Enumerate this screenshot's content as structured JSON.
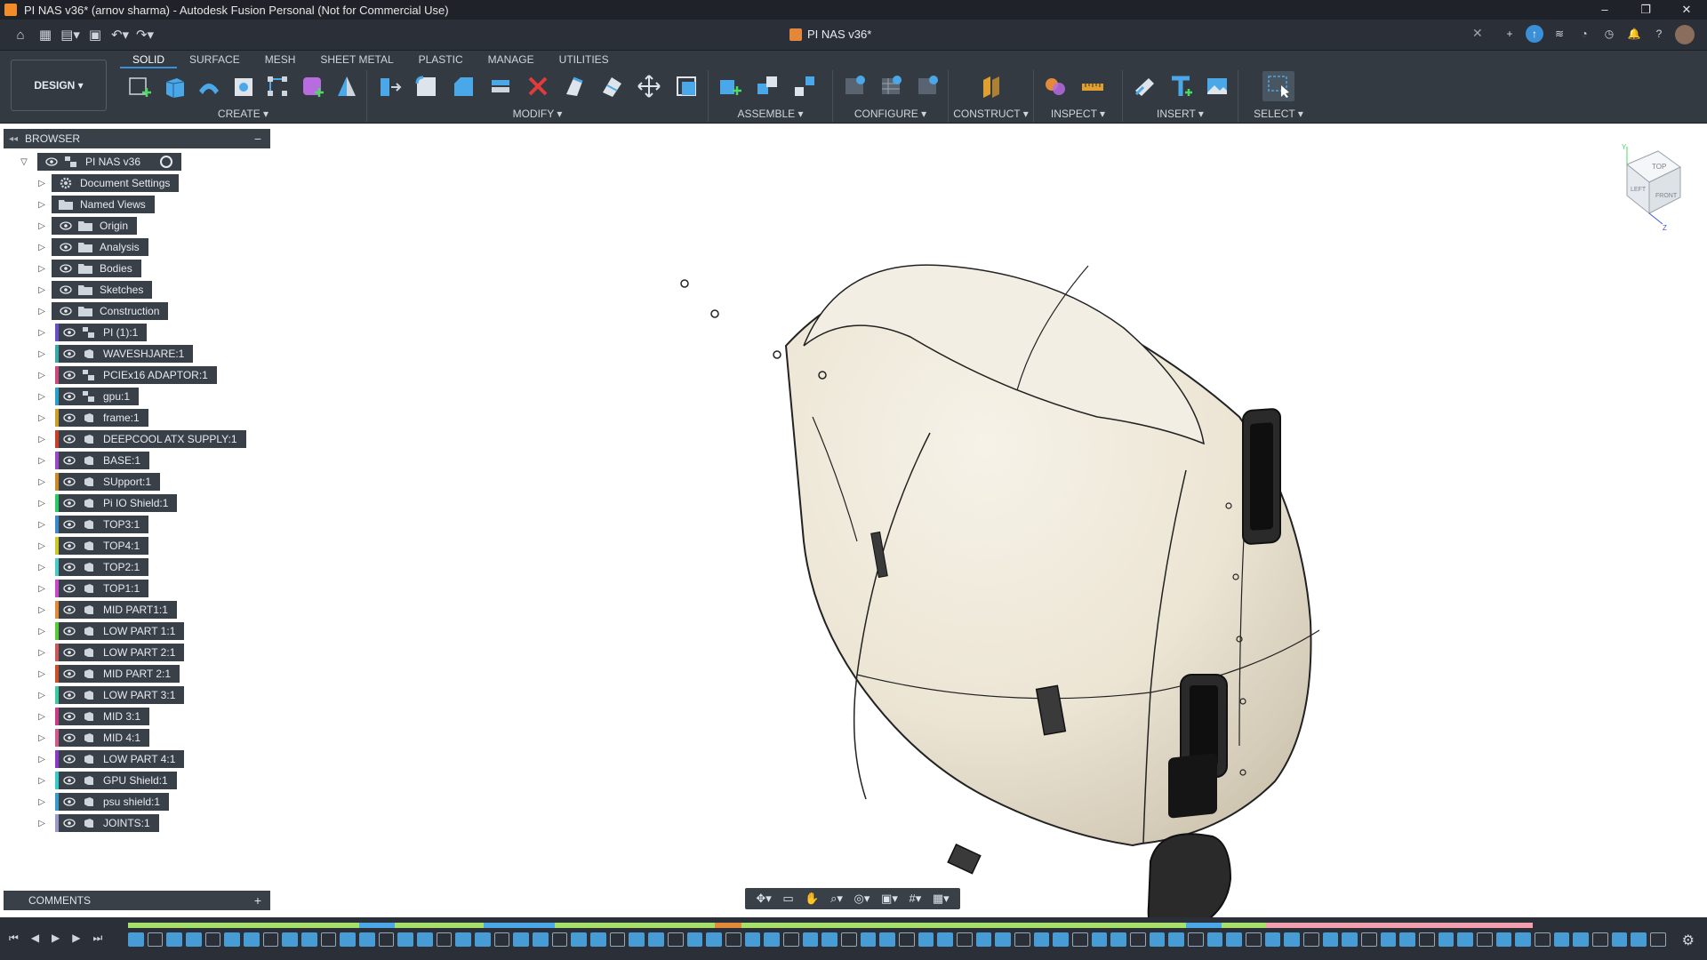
{
  "window": {
    "title": "PI NAS v36* (arnov sharma) - Autodesk Fusion Personal (Not for Commercial Use)",
    "controls": [
      "–",
      "❐",
      "✕"
    ]
  },
  "doc_tab": {
    "label": "PI NAS v36*"
  },
  "workspace": {
    "label": "DESIGN ▾"
  },
  "ribbon": {
    "tabs": [
      "SOLID",
      "SURFACE",
      "MESH",
      "SHEET METAL",
      "PLASTIC",
      "MANAGE",
      "UTILITIES"
    ],
    "groups": [
      {
        "label": "CREATE ▾"
      },
      {
        "label": "MODIFY ▾"
      },
      {
        "label": "ASSEMBLE ▾"
      },
      {
        "label": "CONFIGURE ▾"
      },
      {
        "label": "CONSTRUCT ▾"
      },
      {
        "label": "INSPECT ▾"
      },
      {
        "label": "INSERT ▾"
      },
      {
        "label": "SELECT ▾"
      }
    ]
  },
  "browser": {
    "title": "BROWSER",
    "root": "PI NAS v36",
    "items": [
      {
        "label": "Document Settings",
        "kind": "settings"
      },
      {
        "label": "Named Views",
        "kind": "folder"
      },
      {
        "label": "Origin",
        "kind": "folder"
      },
      {
        "label": "Analysis",
        "kind": "folder"
      },
      {
        "label": "Bodies",
        "kind": "folder"
      },
      {
        "label": "Sketches",
        "kind": "folder"
      },
      {
        "label": "Construction",
        "kind": "folder"
      },
      {
        "label": "PI (1):1",
        "kind": "assembly",
        "color": "#6a4fc9"
      },
      {
        "label": "WAVESHJARE:1",
        "kind": "component",
        "color": "#3aa8a8"
      },
      {
        "label": "PCIEx16 ADAPTOR:1",
        "kind": "assembly",
        "color": "#c94a7a"
      },
      {
        "label": "gpu:1",
        "kind": "assembly",
        "color": "#2aa0c9"
      },
      {
        "label": "frame:1",
        "kind": "component",
        "color": "#c9a02a"
      },
      {
        "label": "DEEPCOOL ATX SUPPLY:1",
        "kind": "component",
        "color": "#c9402a"
      },
      {
        "label": "BASE:1",
        "kind": "component",
        "color": "#9a4ac9"
      },
      {
        "label": "SUpport:1",
        "kind": "component",
        "color": "#c98a2a"
      },
      {
        "label": "Pi IO Shield:1",
        "kind": "component",
        "color": "#2ac96a"
      },
      {
        "label": "TOP3:1",
        "kind": "component",
        "color": "#3a8ac9"
      },
      {
        "label": "TOP4:1",
        "kind": "component",
        "color": "#c9c92a"
      },
      {
        "label": "TOP2:1",
        "kind": "component",
        "color": "#4ac9c9"
      },
      {
        "label": "TOP1:1",
        "kind": "component",
        "color": "#c94ac9"
      },
      {
        "label": "MID PART1:1",
        "kind": "component",
        "color": "#e08a3a"
      },
      {
        "label": "LOW PART 1:1",
        "kind": "component",
        "color": "#5ac93a"
      },
      {
        "label": "LOW PART 2:1",
        "kind": "component",
        "color": "#c95a5a"
      },
      {
        "label": "MID PART 2:1",
        "kind": "component",
        "color": "#c9502a"
      },
      {
        "label": "LOW PART 3:1",
        "kind": "component",
        "color": "#3ac9a0"
      },
      {
        "label": "MID 3:1",
        "kind": "component",
        "color": "#c93a8a"
      },
      {
        "label": "MID 4:1",
        "kind": "component",
        "color": "#d05a8a"
      },
      {
        "label": "LOW PART 4:1",
        "kind": "component",
        "color": "#8a3ac9"
      },
      {
        "label": "GPU Shield:1",
        "kind": "component",
        "color": "#3ac9c9"
      },
      {
        "label": "psu shield:1",
        "kind": "component",
        "color": "#3a9ac9"
      },
      {
        "label": "JOINTS:1",
        "kind": "component",
        "color": "#9a9ac9"
      }
    ]
  },
  "comments": {
    "title": "COMMENTS",
    "add": "+"
  },
  "viewcube": {
    "top": "TOP",
    "front": "FRONT",
    "left": "LEFT",
    "axis_y": "Y",
    "axis_z": "Z"
  },
  "colors": {
    "accent": "#3b8fd6",
    "panel": "#3a4048",
    "ribbon": "#343a42",
    "model": "#efe9dc"
  }
}
